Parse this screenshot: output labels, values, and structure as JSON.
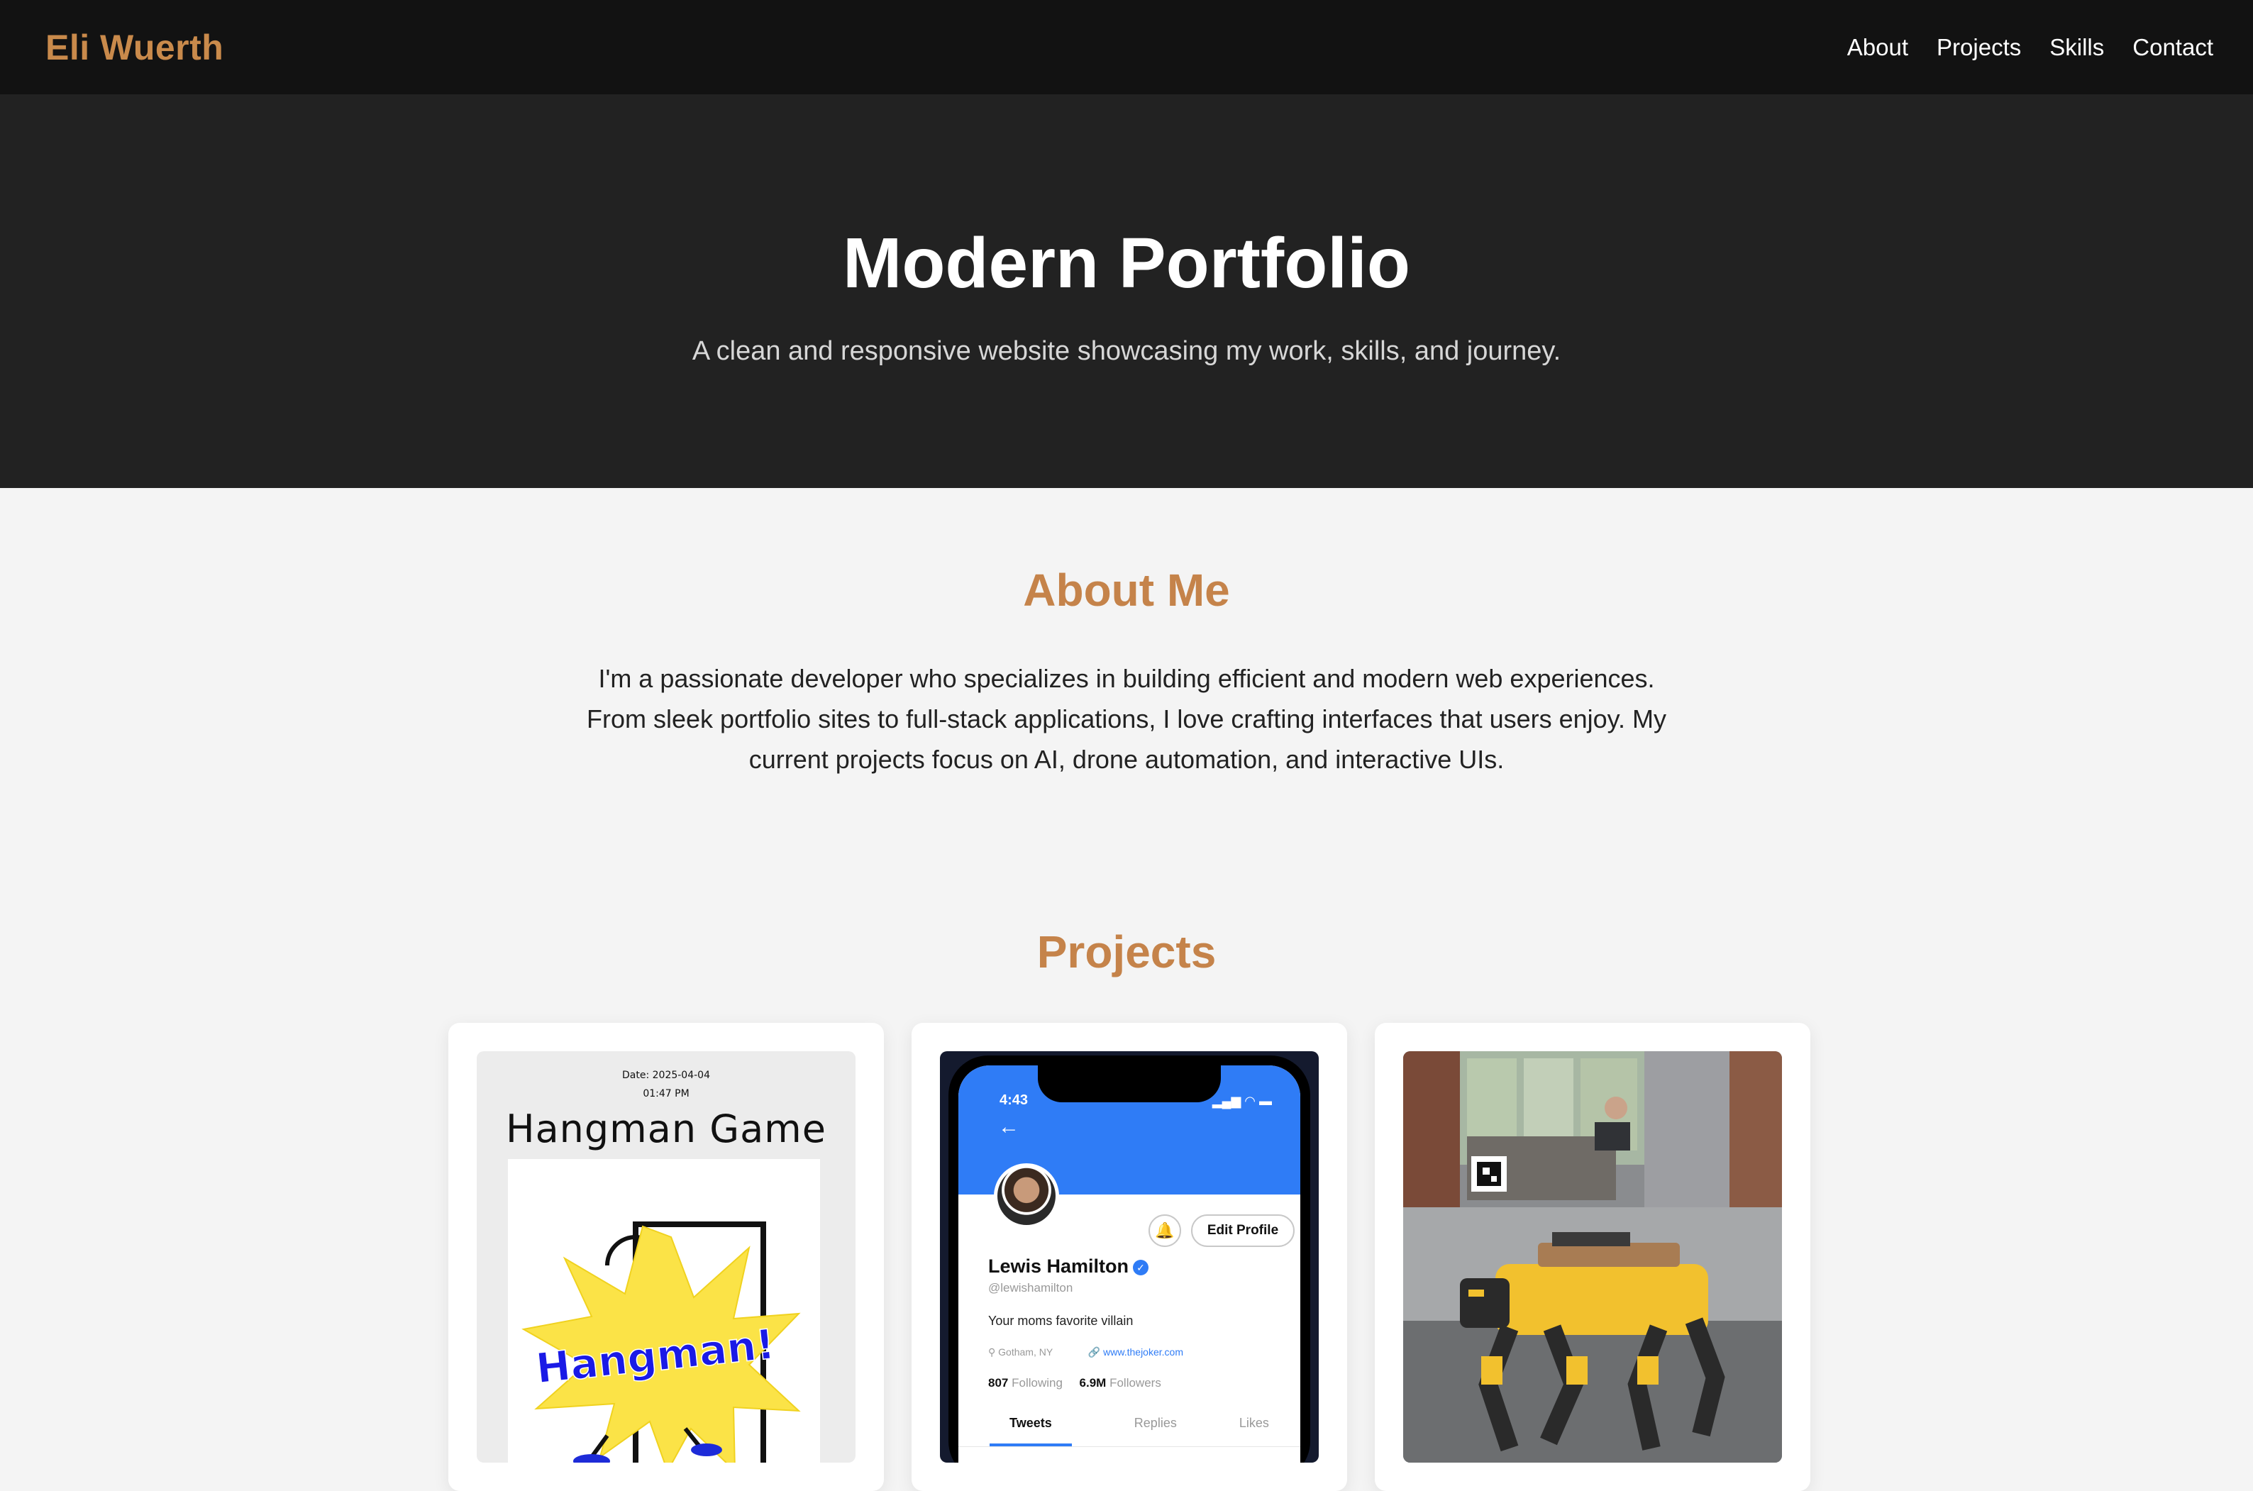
{
  "nav": {
    "brand": "Eli Wuerth",
    "links": [
      "About",
      "Projects",
      "Skills",
      "Contact"
    ]
  },
  "hero": {
    "title": "Modern Portfolio",
    "subtitle": "A clean and responsive website showcasing my work, skills, and journey."
  },
  "about": {
    "heading": "About Me",
    "text": "I'm a passionate developer who specializes in building efficient and modern web experiences. From sleek portfolio sites to full-stack applications, I love crafting interfaces that users enjoy. My current projects focus on AI, drone automation, and interactive UIs."
  },
  "projects": {
    "heading": "Projects",
    "hangman": {
      "date": "Date: 2025-04-04",
      "time": "01:47 PM",
      "title": "Hangman Game",
      "logo_text": "Hangman!"
    },
    "phone": {
      "clock": "4:43",
      "edit_button": "Edit Profile",
      "name": "Lewis Hamilton",
      "handle": "@lewishamilton",
      "bio": "Your moms favorite villain",
      "location": "Gotham, NY",
      "link": "www.thejoker.com",
      "following_count": "807",
      "following_label": "Following",
      "followers_count": "6.9M",
      "followers_label": "Followers",
      "tabs": [
        "Tweets",
        "Replies",
        "Likes"
      ]
    }
  },
  "colors": {
    "accent": "#c5834a",
    "nav_bg": "#121212",
    "hero_bg": "#222222",
    "page_bg": "#f4f4f4",
    "twitter_blue": "#2f7cf6"
  }
}
